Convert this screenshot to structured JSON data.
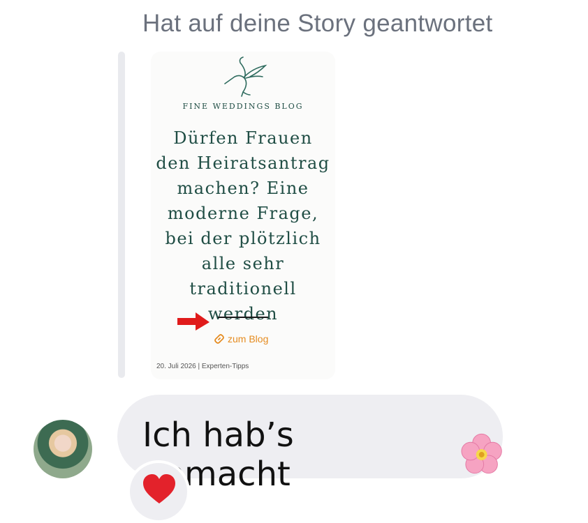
{
  "reply": {
    "header": "Hat auf deine Story geantwortet"
  },
  "story": {
    "blog_name": "FINE WEDDINGS BLOG",
    "headline": "Dürfen Frauen den Heiratsantrag machen? Eine moderne Frage, bei der plötzlich alle sehr traditionell werden",
    "link_label": "zum Blog",
    "date_line": "20. Juli 2026 | Experten-Tipps",
    "colors": {
      "brand_green": "#1f4d44",
      "arrow_red": "#e01b1b"
    }
  },
  "message": {
    "text": "Ich hab’s gemacht",
    "emoji_icon": "cherry-blossom-icon",
    "reaction_icon": "red-heart-icon"
  },
  "colors": {
    "bubble": "#eeeef2",
    "header_text": "#6b717d"
  }
}
